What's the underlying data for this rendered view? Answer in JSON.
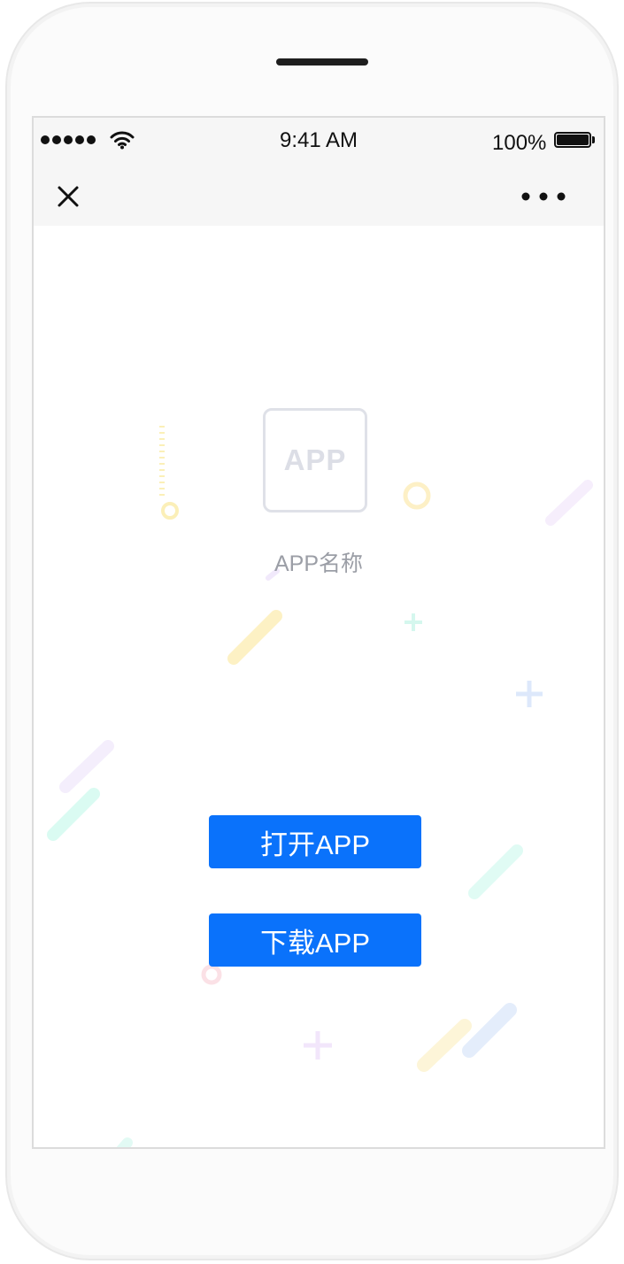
{
  "status_bar": {
    "time": "9:41 AM",
    "battery": "100%"
  },
  "nav": {
    "close_icon": "close-icon",
    "more_icon": "more-dots-icon"
  },
  "app": {
    "icon_label": "APP",
    "name": "APP名称"
  },
  "buttons": {
    "open_label": "打开APP",
    "download_label": "下载APP"
  },
  "colors": {
    "primary": "#0a72fb",
    "nav_bg": "#f6f6f6"
  }
}
